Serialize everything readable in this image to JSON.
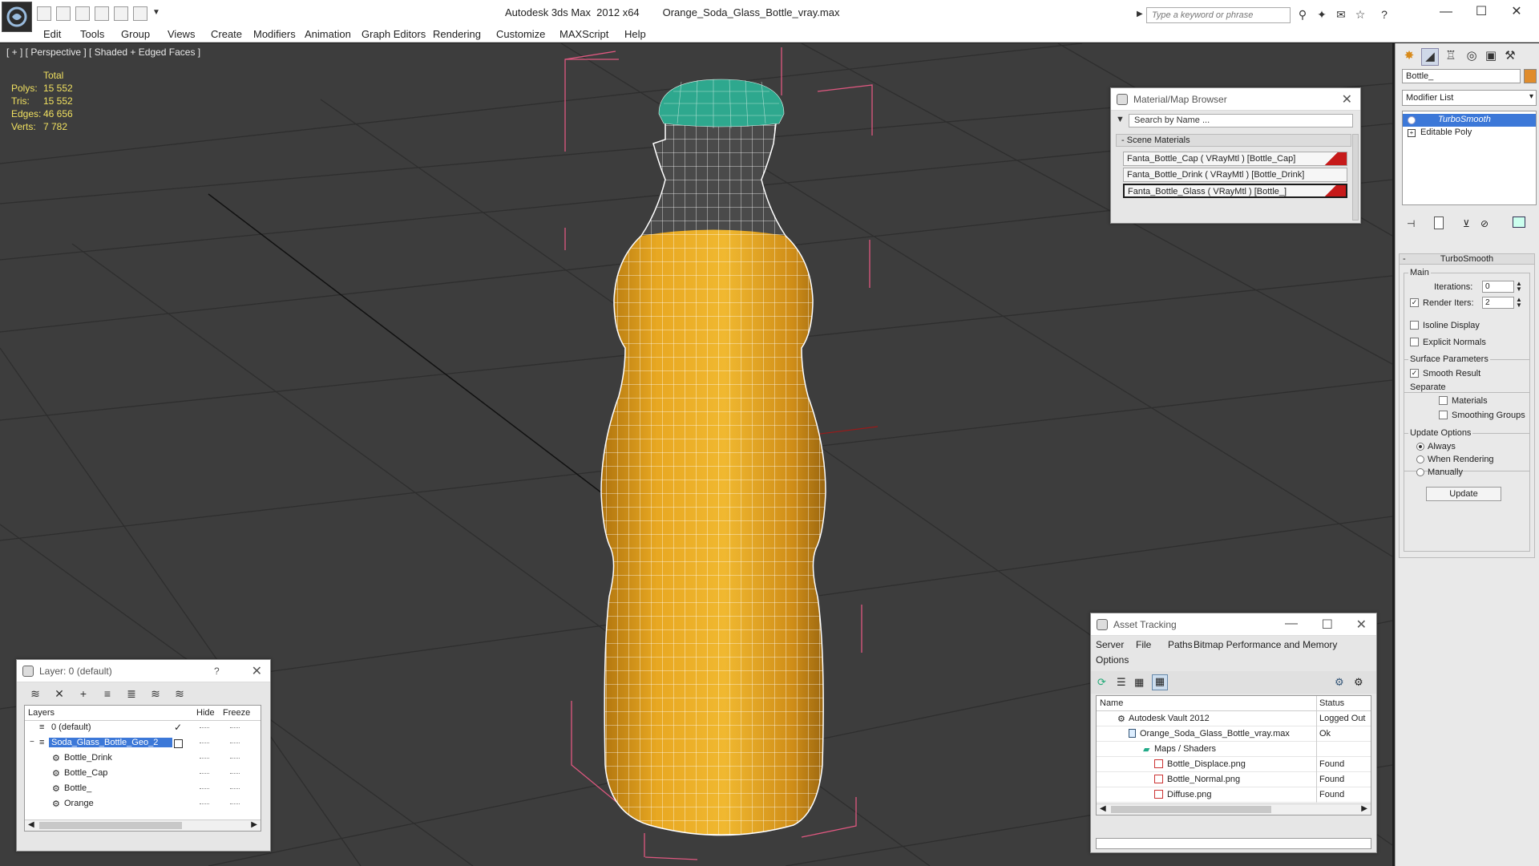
{
  "titlebar": {
    "app": "Autodesk 3ds Max  2012 x64",
    "file": "Orange_Soda_Glass_Bottle_vray.max",
    "search_placeholder": "Type a keyword or phrase"
  },
  "menu": [
    "Edit",
    "Tools",
    "Group",
    "Views",
    "Create",
    "Modifiers",
    "Animation",
    "Graph Editors",
    "Rendering",
    "Customize",
    "MAXScript",
    "Help"
  ],
  "viewport": {
    "label": "[ + ] [ Perspective ] [ Shaded + Edged Faces ]",
    "stats_header": "Total",
    "stats": [
      {
        "k": "Polys:",
        "v": "15 552"
      },
      {
        "k": "Tris:",
        "v": "15 552"
      },
      {
        "k": "Edges:",
        "v": "46 656"
      },
      {
        "k": "Verts:",
        "v": "7 782"
      }
    ]
  },
  "command_panel": {
    "object_name": "Bottle_",
    "modifier_list": "Modifier List",
    "stack": [
      "TurboSmooth",
      "Editable Poly"
    ],
    "rollout": "TurboSmooth",
    "main_label": "Main",
    "iterations_label": "Iterations:",
    "iterations_value": "0",
    "render_iters_label": "Render Iters:",
    "render_iters_value": "2",
    "isoline": "Isoline Display",
    "explicit_normals": "Explicit Normals",
    "surface_params": "Surface Parameters",
    "smooth_result": "Smooth Result",
    "separate": "Separate",
    "materials": "Materials",
    "smoothing_groups": "Smoothing Groups",
    "update_options": "Update Options",
    "always": "Always",
    "when_rendering": "When Rendering",
    "manually": "Manually",
    "update_btn": "Update"
  },
  "material_browser": {
    "title": "Material/Map Browser",
    "search": "Search by Name ...",
    "section": "Scene Materials",
    "items": [
      "Fanta_Bottle_Cap  ( VRayMtl ) [Bottle_Cap]",
      "Fanta_Bottle_Drink  ( VRayMtl ) [Bottle_Drink]",
      "Fanta_Bottle_Glass  ( VRayMtl ) [Bottle_]"
    ]
  },
  "layer_window": {
    "title": "Layer: 0 (default)",
    "help": "?",
    "col_layers": "Layers",
    "col_hide": "Hide",
    "col_freeze": "Freeze",
    "rows": [
      {
        "name": "0 (default)",
        "indent": 0
      },
      {
        "name": "Soda_Glass_Bottle_Geo_2",
        "indent": 0
      },
      {
        "name": "Bottle_Drink",
        "indent": 1
      },
      {
        "name": "Bottle_Cap",
        "indent": 1
      },
      {
        "name": "Bottle_",
        "indent": 1
      },
      {
        "name": "Orange",
        "indent": 1
      }
    ]
  },
  "asset_tracking": {
    "title": "Asset Tracking",
    "menu": [
      "Server",
      "File",
      "Paths",
      "Bitmap Performance and Memory",
      "Options"
    ],
    "col_name": "Name",
    "col_status": "Status",
    "rows": [
      {
        "name": "Autodesk Vault 2012",
        "status": "Logged Out",
        "indent": 1
      },
      {
        "name": "Orange_Soda_Glass_Bottle_vray.max",
        "status": "Ok",
        "indent": 2
      },
      {
        "name": "Maps / Shaders",
        "status": "",
        "indent": 3
      },
      {
        "name": "Bottle_Displace.png",
        "status": "Found",
        "indent": 4
      },
      {
        "name": "Bottle_Normal.png",
        "status": "Found",
        "indent": 4
      },
      {
        "name": "Diffuse.png",
        "status": "Found",
        "indent": 4
      }
    ]
  },
  "colors": {
    "accent": "#3c78d8",
    "bottle_liquid": "#e0a020",
    "cap": "#2ea88e",
    "stats_text": "#f0e060"
  }
}
